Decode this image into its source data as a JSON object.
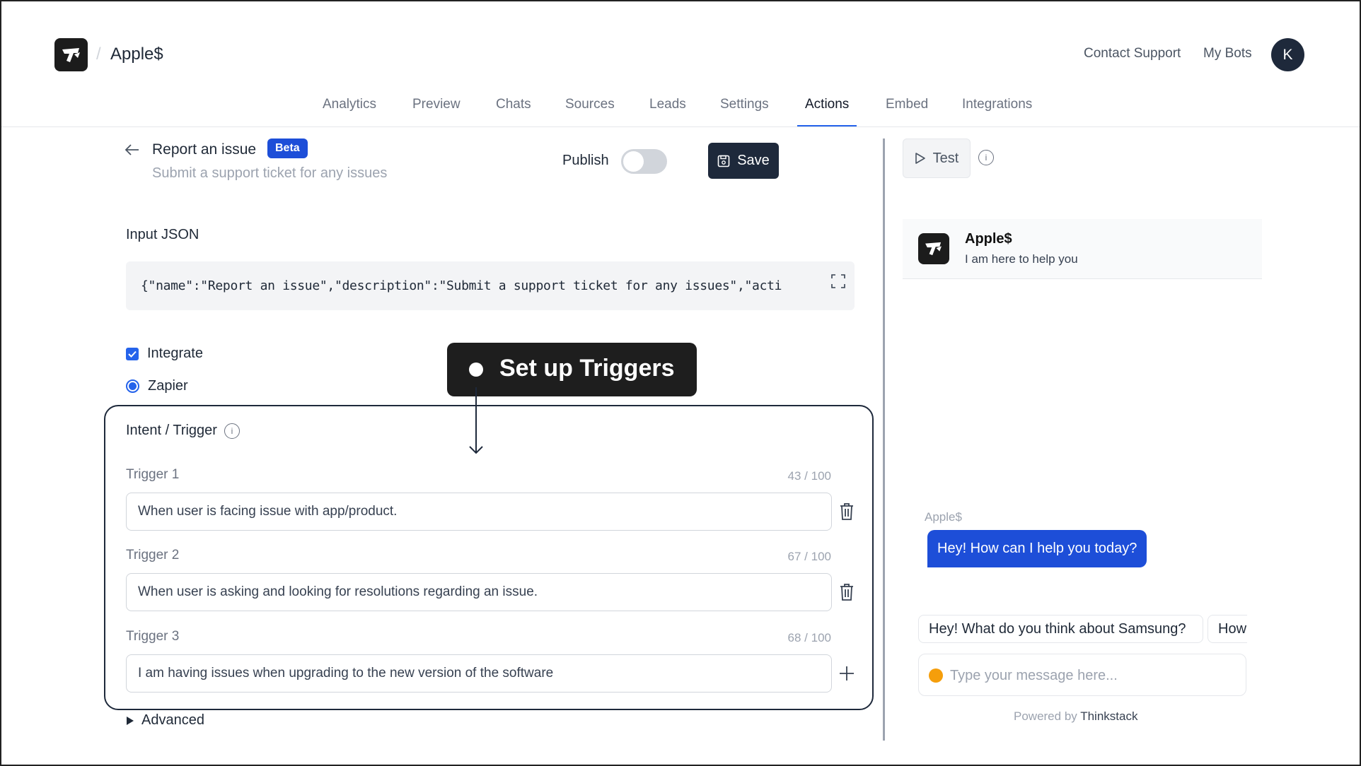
{
  "header": {
    "brand": "Apple$",
    "breadcrumb_separator": "/",
    "links": [
      "Contact Support",
      "My Bots"
    ],
    "avatar_initial": "K",
    "logo_icon": "thinkstack-logo-icon"
  },
  "tabs": [
    {
      "label": "Analytics",
      "active": false
    },
    {
      "label": "Preview",
      "active": false
    },
    {
      "label": "Chats",
      "active": false
    },
    {
      "label": "Sources",
      "active": false
    },
    {
      "label": "Leads",
      "active": false
    },
    {
      "label": "Settings",
      "active": false
    },
    {
      "label": "Actions",
      "active": true
    },
    {
      "label": "Embed",
      "active": false
    },
    {
      "label": "Integrations",
      "active": false
    }
  ],
  "action": {
    "title": "Report an issue",
    "badge": "Beta",
    "description": "Submit a support ticket for any issues",
    "publish_label": "Publish",
    "publish_enabled": false,
    "save_label": "Save"
  },
  "input_json": {
    "label": "Input JSON",
    "value": "{\"name\":\"Report an issue\",\"description\":\"Submit a support ticket for any issues\",\"acti"
  },
  "integrate": {
    "label": "Integrate",
    "checked": true,
    "provider": "Zapier",
    "provider_selected": true
  },
  "intent": {
    "label": "Intent / Trigger",
    "triggers": [
      {
        "label": "Trigger 1",
        "count": "43 / 100",
        "value": "When user is facing issue with app/product.",
        "action_icon": "trash-icon"
      },
      {
        "label": "Trigger 2",
        "count": "67 / 100",
        "value": "When user is asking and looking for resolutions regarding an issue.",
        "action_icon": "trash-icon"
      },
      {
        "label": "Trigger 3",
        "count": "68 / 100",
        "value": "I am having issues when upgrading to the new version of the software",
        "action_icon": "plus-icon"
      }
    ],
    "advanced_label": "Advanced"
  },
  "tooltip": {
    "text": "Set up Triggers"
  },
  "preview": {
    "test_label": "Test",
    "bot_name": "Apple$",
    "bot_subtitle": "I am here to help you",
    "message_sender": "Apple$",
    "bot_message": "Hey! How can I help you today?",
    "suggestions": [
      "Hey! What do you think about Samsung?",
      "How"
    ],
    "input_placeholder": "Type your message here...",
    "powered_by": "Powered by",
    "powered_brand": "Thinkstack"
  },
  "colors": {
    "accent": "#1d4ed8",
    "dark": "#1e293b",
    "tooltip_bg": "#1e1e1e"
  }
}
